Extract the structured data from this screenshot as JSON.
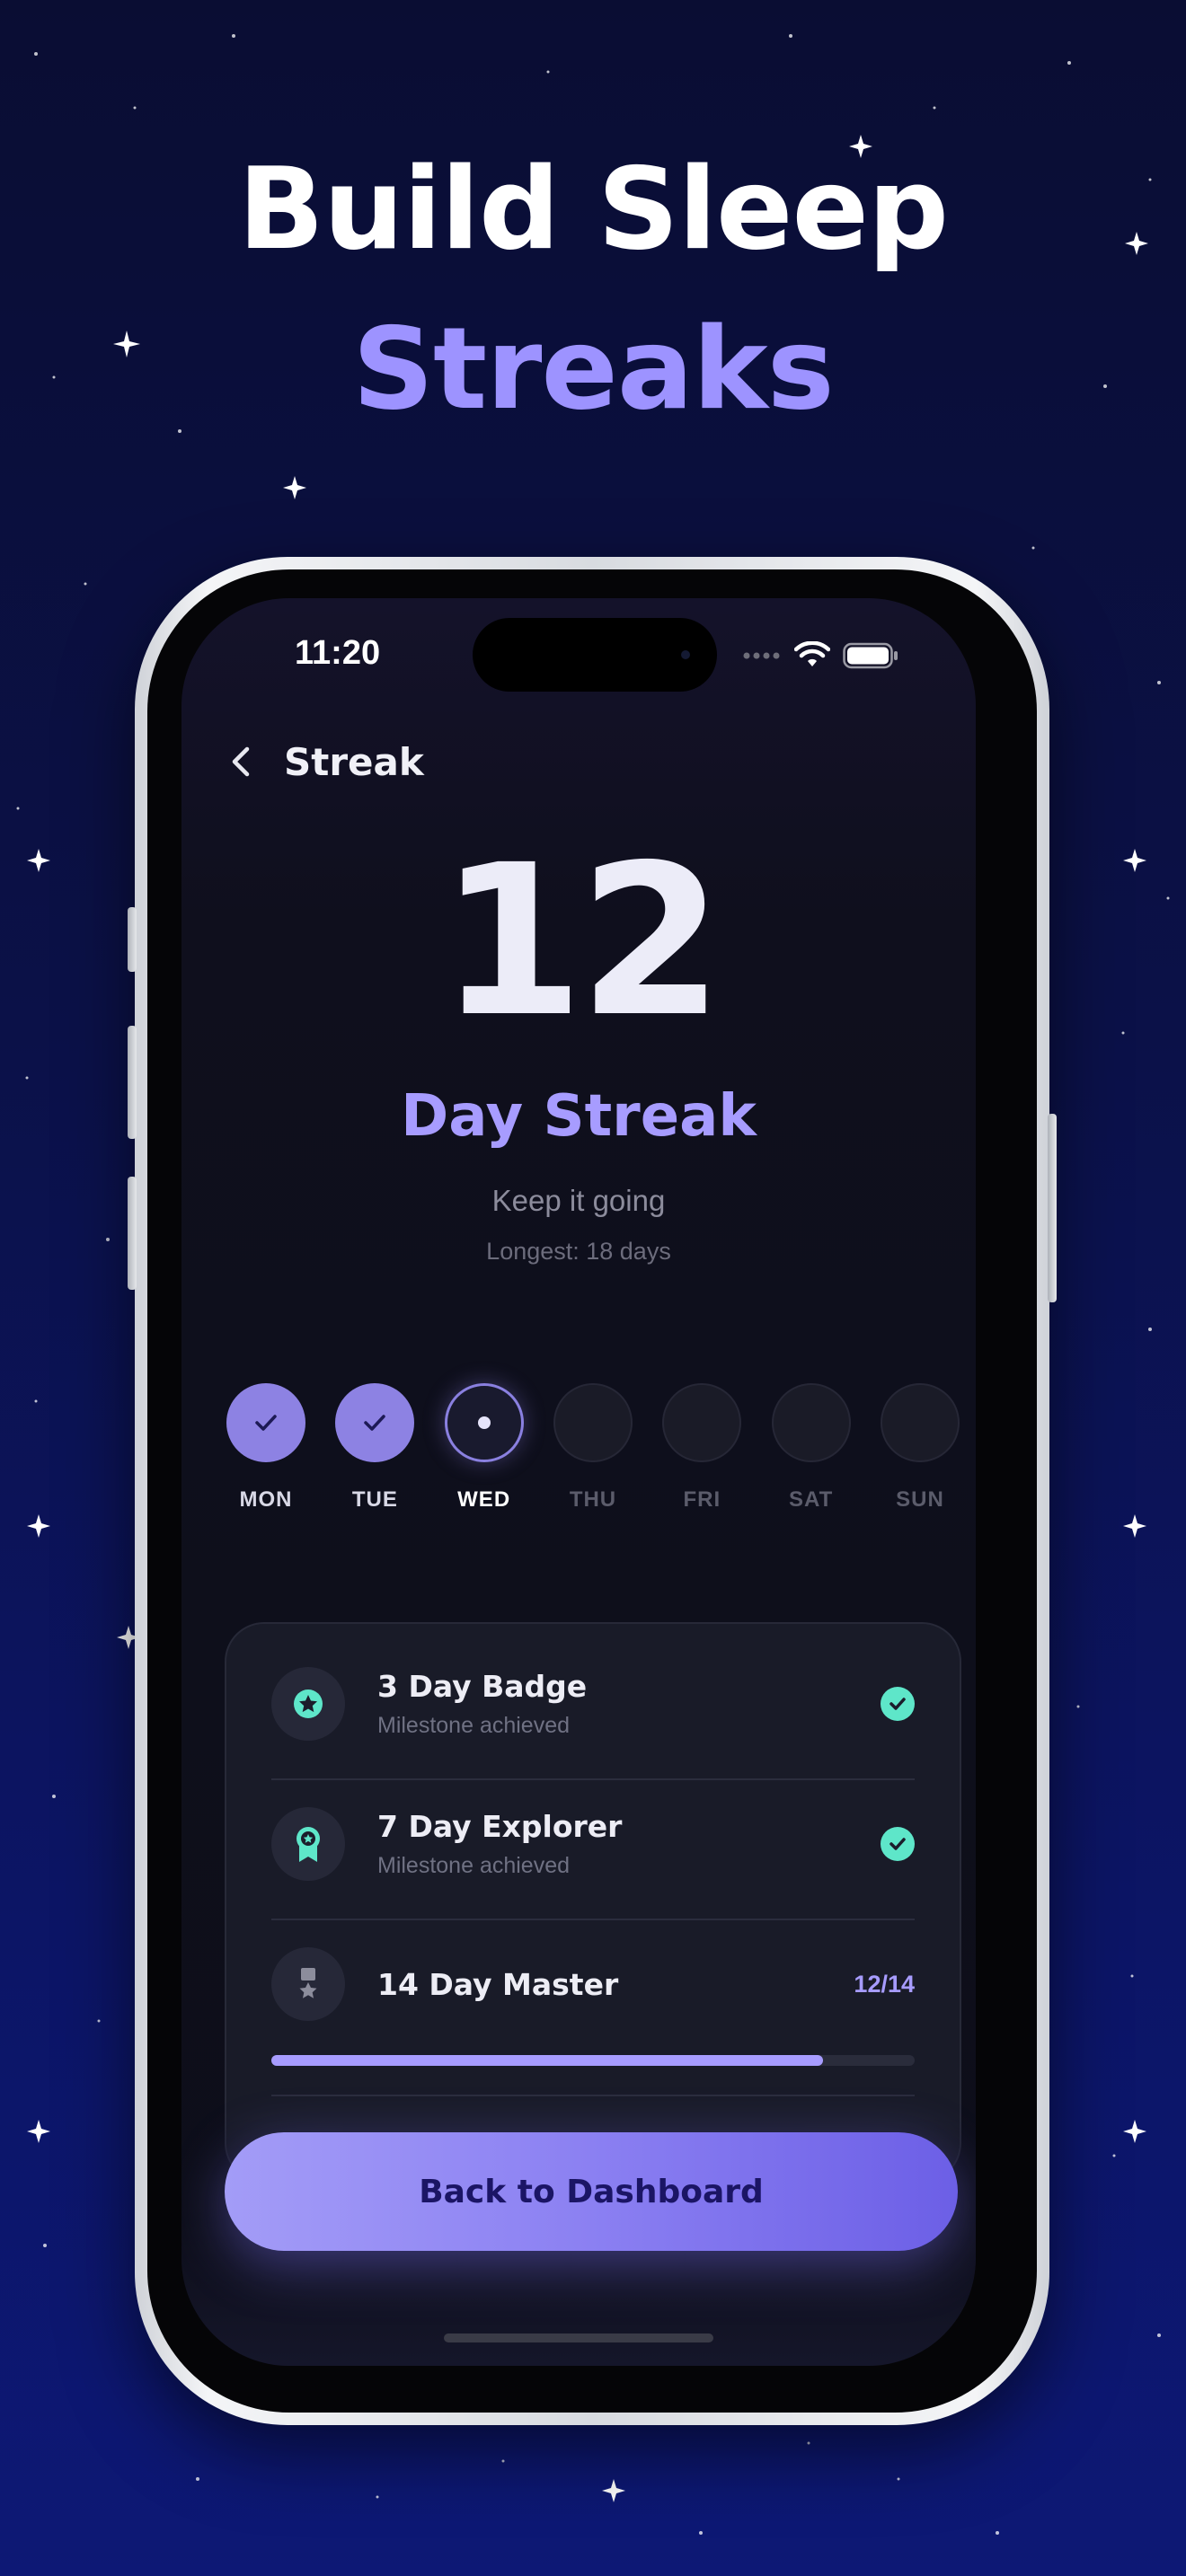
{
  "promo": {
    "headline_line1": "Build Sleep",
    "headline_line2": "Streaks"
  },
  "status_bar": {
    "time": "11:20",
    "icons": [
      "cellular-dots-icon",
      "wifi-icon",
      "battery-icon"
    ]
  },
  "nav": {
    "back_icon": "chevron-left-icon",
    "title": "Streak"
  },
  "streak": {
    "count": "12",
    "label": "Day Streak",
    "message": "Keep it going",
    "longest": "Longest: 18 days"
  },
  "week": [
    {
      "label": "MON",
      "state": "done"
    },
    {
      "label": "TUE",
      "state": "done"
    },
    {
      "label": "WED",
      "state": "today"
    },
    {
      "label": "THU",
      "state": "future"
    },
    {
      "label": "FRI",
      "state": "future"
    },
    {
      "label": "SAT",
      "state": "future"
    },
    {
      "label": "SUN",
      "state": "future"
    }
  ],
  "milestones": [
    {
      "title": "3 Day Badge",
      "subtitle": "Milestone achieved",
      "icon": "star-badge-icon",
      "status_icon": "check-circle-icon"
    },
    {
      "title": "7 Day Explorer",
      "subtitle": "Milestone achieved",
      "icon": "award-ribbon-icon",
      "status_icon": "check-circle-icon"
    },
    {
      "title": "14 Day Master",
      "progress_text": "12/14",
      "progress": 0.857,
      "icon": "medal-icon"
    }
  ],
  "cta": {
    "label": "Back to Dashboard"
  },
  "colors": {
    "accent": "#a79cff",
    "success": "#5ee6c9",
    "background": "#0e0f1b"
  }
}
